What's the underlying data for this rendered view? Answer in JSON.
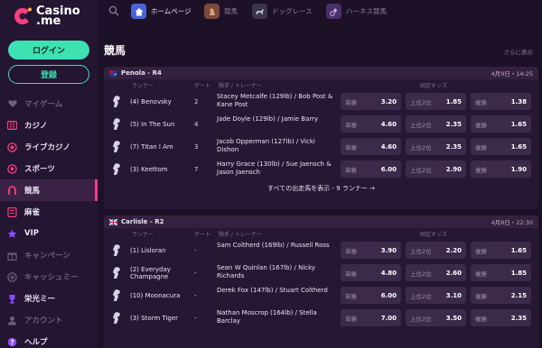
{
  "brand": {
    "line1": "Casino",
    "line2": ".me"
  },
  "auth": {
    "login": "ログイン",
    "register": "登録"
  },
  "sidebar": {
    "items": [
      {
        "label": "マイゲーム",
        "icon": "heart-icon"
      },
      {
        "label": "カジノ",
        "icon": "slot-icon"
      },
      {
        "label": "ライブカジノ",
        "icon": "chip-icon"
      },
      {
        "label": "スポーツ",
        "icon": "ball-icon"
      },
      {
        "label": "競馬",
        "icon": "horseshoe-icon"
      },
      {
        "label": "麻雀",
        "icon": "mahjong-icon"
      },
      {
        "label": "VIP",
        "icon": "star-icon"
      },
      {
        "label": "キャンペーン",
        "icon": "gift-icon"
      },
      {
        "label": "キャッシュミー",
        "icon": "cash-icon"
      },
      {
        "label": "栄光ミー",
        "icon": "trophy-icon"
      },
      {
        "label": "アカウント",
        "icon": "user-icon"
      },
      {
        "label": "ヘルプ",
        "icon": "help-icon"
      }
    ]
  },
  "topnav": {
    "tabs": [
      {
        "label": "ホームページ"
      },
      {
        "label": "競馬"
      },
      {
        "label": "ドッグレース"
      },
      {
        "label": "ハーネス競馬"
      }
    ]
  },
  "main": {
    "title": "競馬",
    "see_more": "さらに表示"
  },
  "columns": {
    "runner": "ランナー",
    "gate": "ゲート",
    "jockey": "騎手 / トレーナー",
    "odds": "固定オッズ"
  },
  "races": [
    {
      "name": "Penola - R4",
      "time": "4月9日・14:25",
      "show_all": "すべての出走馬を表示 - 9 ランナー →",
      "runners": [
        {
          "name": "(4) Benovsky",
          "gate": "2",
          "jockey": "Stacey Metcalfe (129lb) / Bob Post & Kane Post",
          "win_label": "単勝",
          "win": "3.20",
          "place_label": "上位2位",
          "place": "1.85",
          "show_label": "複勝",
          "show": "1.38"
        },
        {
          "name": "(5) In The Sun",
          "gate": "4",
          "jockey": "Jade Doyle (129lb) / Jamie Barry",
          "win_label": "単勝",
          "win": "4.60",
          "place_label": "上位2位",
          "place": "2.35",
          "show_label": "複勝",
          "show": "1.65"
        },
        {
          "name": "(7) Titan I Am",
          "gate": "3",
          "jockey": "Jacob Opperman (127lb) / Vicki Dishon",
          "win_label": "単勝",
          "win": "4.60",
          "place_label": "上位2位",
          "place": "2.35",
          "show_label": "複勝",
          "show": "1.65"
        },
        {
          "name": "(3) Keettom",
          "gate": "7",
          "jockey": "Harry Grace (130lb) / Sue Jaensch & Jason Jaensch",
          "win_label": "単勝",
          "win": "6.00",
          "place_label": "上位2位",
          "place": "2.90",
          "show_label": "複勝",
          "show": "1.90"
        }
      ]
    },
    {
      "name": "Carlisle - R2",
      "time": "4月8日・22:30",
      "runners": [
        {
          "name": "(1) Lisloran",
          "gate": "-",
          "jockey": "Sam Coltherd (169lb) / Russell Ross",
          "win_label": "単勝",
          "win": "3.90",
          "place_label": "上位2位",
          "place": "2.20",
          "show_label": "複勝",
          "show": "1.65"
        },
        {
          "name": "(2) Everyday Champagne",
          "gate": "-",
          "jockey": "Sean W Quinlan (167lb) / Nicky Richards",
          "win_label": "単勝",
          "win": "4.80",
          "place_label": "上位2位",
          "place": "2.60",
          "show_label": "複勝",
          "show": "1.85"
        },
        {
          "name": "(10) Moonacura",
          "gate": "-",
          "jockey": "Derek Fox (147lb) / Stuart Coltherd",
          "win_label": "単勝",
          "win": "6.00",
          "place_label": "上位2位",
          "place": "3.10",
          "show_label": "複勝",
          "show": "2.15"
        },
        {
          "name": "(3) Storm Tiger",
          "gate": "-",
          "jockey": "Nathan Moscrop (164lb) / Stella Barclay",
          "win_label": "単勝",
          "win": "7.00",
          "place_label": "上位2位",
          "place": "3.50",
          "show_label": "複勝",
          "show": "2.35"
        }
      ]
    }
  ]
}
